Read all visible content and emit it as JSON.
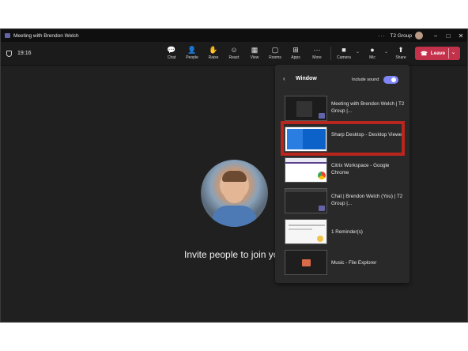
{
  "window": {
    "title": "Meeting with Brendon Welch",
    "org": "T2 Group",
    "more": "···",
    "minimize": "−",
    "maximize": "□",
    "close": "✕"
  },
  "meeting": {
    "timer": "19:16"
  },
  "toolbar": {
    "chat": "Chat",
    "people": "People",
    "raise": "Raise",
    "react": "React",
    "view": "View",
    "rooms": "Rooms",
    "apps": "Apps",
    "more": "More",
    "camera": "Camera",
    "mic": "Mic",
    "share": "Share",
    "leave": "Leave"
  },
  "icons": {
    "chat": "💬",
    "people": "👤",
    "raise": "✋",
    "react": "☺",
    "view": "▦",
    "rooms": "▢",
    "apps": "⊞",
    "more": "···",
    "camera": "■",
    "mic": "●",
    "share": "⬆",
    "phone": "☎",
    "back": "‹",
    "caret": "⌄"
  },
  "stage": {
    "invite_text": "Invite people to join yo"
  },
  "share_panel": {
    "title": "Window",
    "include_sound_label": "Include sound",
    "include_sound": true,
    "windows": [
      {
        "label": "Meeting with Brendon Welch | T2 Group |..."
      },
      {
        "label": "Sharp Desktop - Desktop Viewer",
        "highlighted": true
      },
      {
        "label": "Citrix Workspace - Google Chrome"
      },
      {
        "label": "Chat | Brendon Welch (You) | T2 Group |..."
      },
      {
        "label": "1 Reminder(s)"
      },
      {
        "label": "Music - File Explorer"
      }
    ]
  },
  "colors": {
    "leave": "#c4314b",
    "accent": "#7f85f5",
    "highlight": "#b8261e"
  }
}
